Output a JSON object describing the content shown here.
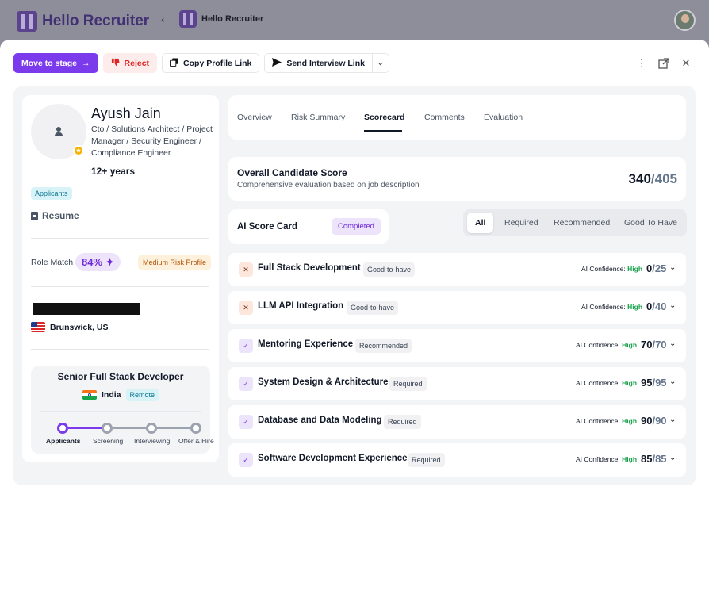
{
  "background": {
    "brand": "Hello Recruiter",
    "nav_title": "Hello Recruiter"
  },
  "toolbar": {
    "move_to_stage": "Move to stage",
    "reject": "Reject",
    "copy_profile_link": "Copy Profile Link",
    "send_interview_link": "Send Interview Link"
  },
  "candidate": {
    "name": "Ayush Jain",
    "title": "Cto / Solutions Architect / Project Manager / Security Engineer / Compliance Engineer",
    "experience": "12+ years",
    "stage": "Applicants",
    "resume_label": "Resume",
    "role_match_label": "Role Match",
    "role_match_value": "84%",
    "risk_label": "Medium Risk Profile",
    "location": "Brunswick, US"
  },
  "job": {
    "title": "Senior Full Stack Developer",
    "country": "India",
    "work_mode": "Remote",
    "pipeline": [
      "Applicants",
      "Screening",
      "Interviewing",
      "Offer & Hire"
    ],
    "current_stage_index": 0
  },
  "tabs": [
    "Overview",
    "Risk Summary",
    "Scorecard",
    "Comments",
    "Evaluation"
  ],
  "active_tab": "Scorecard",
  "overall": {
    "title": "Overall Candidate Score",
    "subtitle": "Comprehensive evaluation based on job description",
    "score": "340",
    "max": "/405"
  },
  "ai_card": {
    "title": "AI Score Card",
    "status": "Completed"
  },
  "filters": [
    "All",
    "Required",
    "Recommended",
    "Good To Have"
  ],
  "active_filter": "All",
  "confidence_label": "AI Confidence:",
  "skills": [
    {
      "name": "Full Stack Development",
      "tag": "Good-to-have",
      "confidence": "High",
      "score": "0",
      "max": "/25",
      "status": "fail"
    },
    {
      "name": "LLM API Integration",
      "tag": "Good-to-have",
      "confidence": "High",
      "score": "0",
      "max": "/40",
      "status": "fail"
    },
    {
      "name": "Mentoring Experience",
      "tag": "Recommended",
      "confidence": "High",
      "score": "70",
      "max": "/70",
      "status": "pass"
    },
    {
      "name": "System Design & Architecture",
      "tag": "Required",
      "confidence": "High",
      "score": "95",
      "max": "/95",
      "status": "pass"
    },
    {
      "name": "Database and Data Modeling",
      "tag": "Required",
      "confidence": "High",
      "score": "90",
      "max": "/90",
      "status": "pass"
    },
    {
      "name": "Software Development Experience",
      "tag": "Required",
      "confidence": "High",
      "score": "85",
      "max": "/85",
      "status": "pass"
    }
  ],
  "colors": {
    "accent": "#7c3aed",
    "reject": "#dc2626",
    "high_confidence": "#16a34a"
  }
}
